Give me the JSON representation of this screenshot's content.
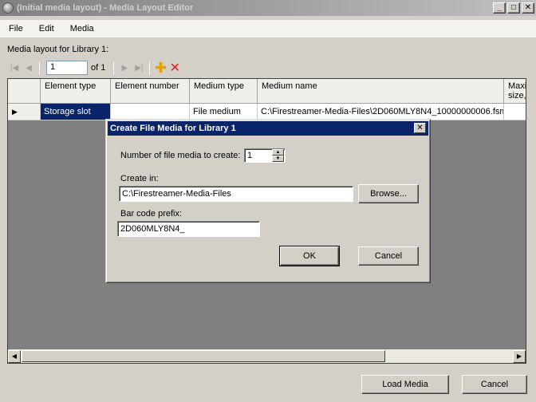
{
  "window": {
    "title": "(Initial media layout) - Media Layout Editor"
  },
  "menu": {
    "file": "File",
    "edit": "Edit",
    "media": "Media"
  },
  "layout_label": "Media layout for Library 1:",
  "toolbar": {
    "position_value": "1",
    "of_label": "of 1"
  },
  "grid": {
    "columns": [
      "Element type",
      "Element number",
      "Medium type",
      "Medium name",
      "Maxi size,"
    ],
    "rows": [
      {
        "element_type": "Storage slot",
        "element_number": "",
        "medium_type": "File medium",
        "medium_name": "C:\\Firestreamer-Media-Files\\2D060MLY8N4_10000000006.fsm",
        "max_size": ""
      }
    ]
  },
  "dialog": {
    "title": "Create File Media for Library 1",
    "count_label": "Number of file media to create:",
    "count_value": "1",
    "create_in_label": "Create in:",
    "create_in_value": "C:\\Firestreamer-Media-Files",
    "browse_label": "Browse...",
    "barcode_label": "Bar code prefix:",
    "barcode_value": "2D060MLY8N4_",
    "ok_label": "OK",
    "cancel_label": "Cancel"
  },
  "footer": {
    "load_media_label": "Load Media",
    "cancel_label": "Cancel"
  }
}
